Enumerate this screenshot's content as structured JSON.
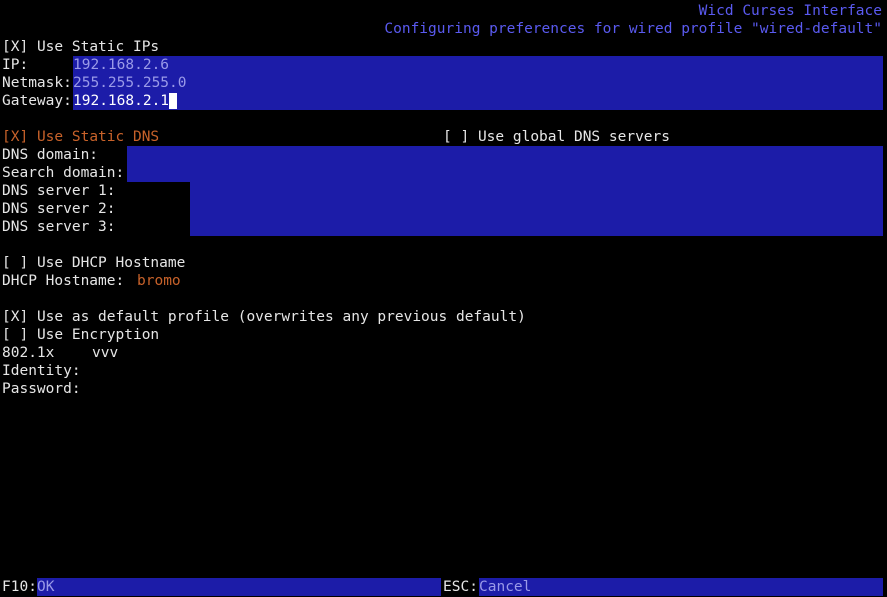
{
  "header": {
    "title": "Wicd Curses Interface",
    "subtitle": "Configuring preferences for wired profile \"wired-default\""
  },
  "static_ip": {
    "checkbox": "[X]",
    "label": "Use Static IPs",
    "ip_label": "IP:",
    "ip_value": "192.168.2.6",
    "netmask_label": "Netmask:",
    "netmask_value": "255.255.255.0",
    "gateway_label": "Gateway:",
    "gateway_value": "192.168.2.1"
  },
  "static_dns": {
    "checkbox": "[X]",
    "label": "Use Static DNS",
    "global_checkbox": "[ ]",
    "global_label": "Use global DNS servers",
    "domain_label": "DNS domain:",
    "search_label": "Search domain:",
    "server1_label": "DNS server 1:",
    "server2_label": "DNS server 2:",
    "server3_label": "DNS server 3:"
  },
  "dhcp": {
    "checkbox": "[ ]",
    "label": "Use DHCP Hostname",
    "hostname_label": "DHCP Hostname:",
    "hostname_value": "bromo"
  },
  "profile": {
    "default_checkbox": "[X]",
    "default_label": "Use as default profile (overwrites any previous default)",
    "encryption_checkbox": "[ ]",
    "encryption_label": "Use Encryption",
    "enc_type": "802.1x",
    "enc_value": "vvv",
    "identity_label": "Identity:",
    "password_label": "Password:"
  },
  "footer": {
    "f10_key": "F10:",
    "ok_label": "OK",
    "esc_key": "ESC:",
    "cancel_label": "Cancel"
  },
  "colors": {
    "background": "#000000",
    "field_blue": "#1c1ca8",
    "header_blue": "#5a5af0",
    "focus_orange": "#c8622a"
  }
}
